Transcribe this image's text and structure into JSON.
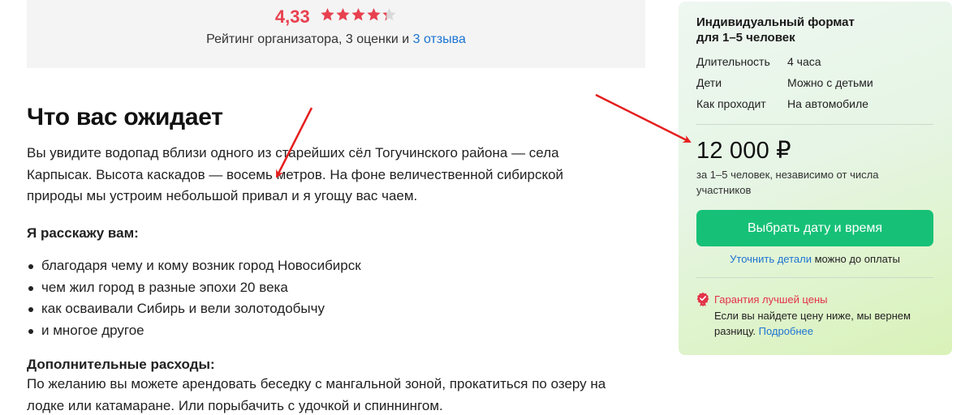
{
  "rating": {
    "value": "4,33",
    "stars_filled": 4.33,
    "stars_total": 5,
    "caption_prefix": "Рейтинг организатора, 3 оценки и ",
    "reviews_link": "3 отзыва",
    "star_color": "#e8404f"
  },
  "content": {
    "title": "Что вас ожидает",
    "intro_line1": "Вы увидите водопад вблизи одного из старейших сёл Тогучинского района — села",
    "intro_line2": "Карпысак. Высота каскадов — восемь метров. На фоне величественной сибирской",
    "intro_line3": "природы мы устроим небольшой привал и я угощу вас чаем.",
    "tell_heading": "Я расскажу вам:",
    "bullets": [
      "благодаря чему и кому возник город Новосибирск",
      "чем жил город в разные эпохи 20 века",
      "как осваивали Сибирь и вели золотодобычу",
      "и многое другое"
    ],
    "extra_heading": "Дополнительные расходы:",
    "extra_line1": "По желанию вы можете арендовать беседку с мангальной зоной, прокатиться по озеру на",
    "extra_line2": "лодке или катамаране. Или порыбачить с удочкой и спиннингом."
  },
  "card": {
    "title_line1": "Индивидуальный формат",
    "title_line2": "для 1–5 человек",
    "rows": [
      {
        "key": "Длительность",
        "value": "4 часа"
      },
      {
        "key": "Дети",
        "value": "Можно с детьми"
      },
      {
        "key": "Как проходит",
        "value": "На автомобиле"
      }
    ],
    "price": "12 000 ₽",
    "price_note_line1": "за 1–5 человек, независимо от числа",
    "price_note_line2": "участников",
    "cta_label": "Выбрать дату и время",
    "clarify_link": "Уточнить детали",
    "clarify_rest": " можно до оплаты",
    "guarantee_title": "Гарантия лучшей цены",
    "guarantee_line1": "Если вы найдете цену ниже, мы вернем",
    "guarantee_line2_prefix": "разницу. ",
    "guarantee_more_link": "Подробнее",
    "accent_color": "#16c177",
    "guarantee_color": "#e33247"
  },
  "icons": {
    "star": "star-icon",
    "guarantee": "badge-check-icon"
  }
}
